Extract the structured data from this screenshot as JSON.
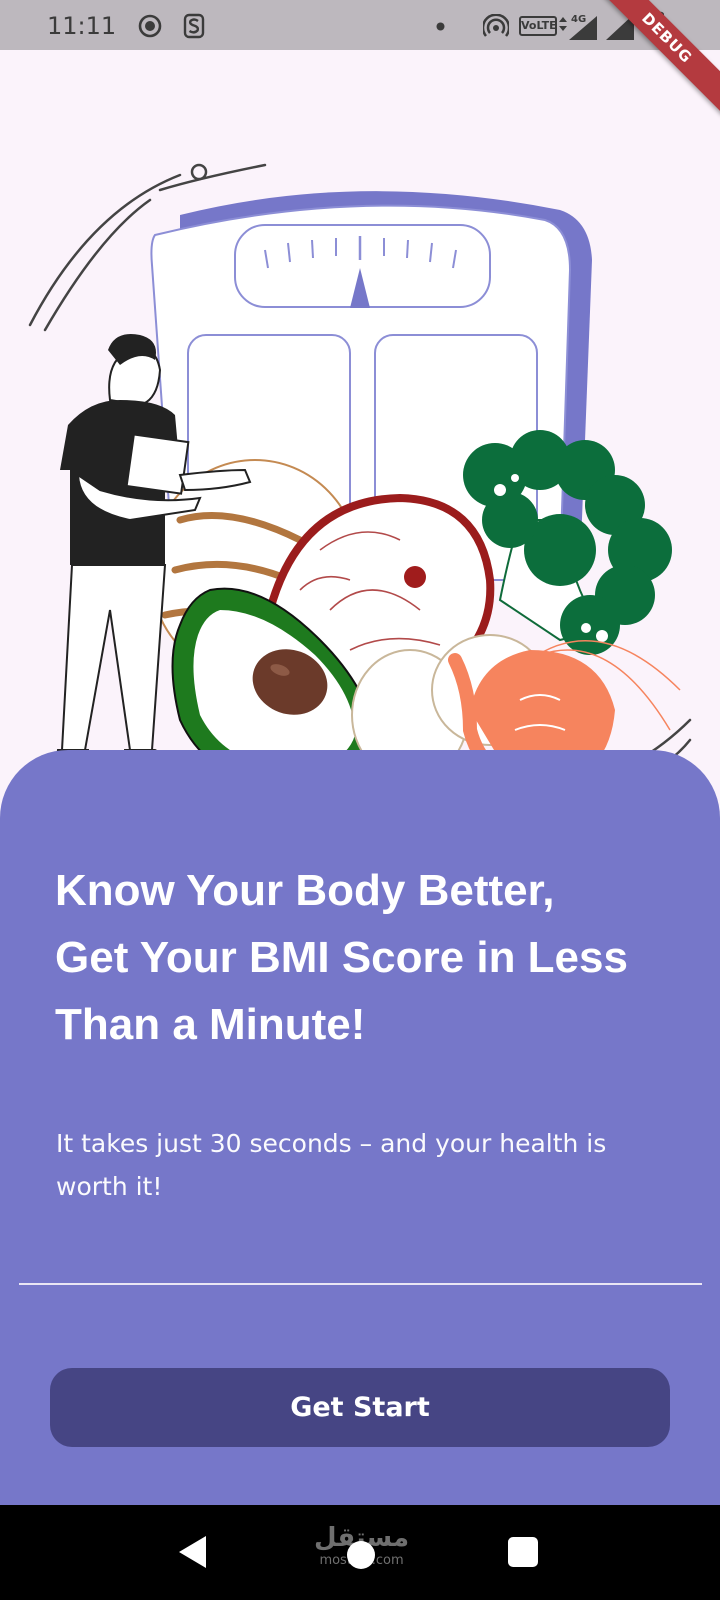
{
  "status_bar": {
    "time": "11:11",
    "icons": [
      "screen-record-icon",
      "s-badge-icon",
      "dot-icon",
      "hotspot-icon",
      "volte-icon",
      "signal-4g-icon",
      "signal-icon",
      "battery-icon"
    ],
    "volte_label": "VoLTE",
    "network_label": "4G"
  },
  "debug_banner": "DEBUG",
  "hero": {
    "illustration": "person-scale-healthy-food-illustration"
  },
  "content": {
    "headline": "Know Your Body Better,\n Get Your BMI Score in Less\nThan a Minute!",
    "subtext": "It takes just 30 seconds – and your health is worth it!",
    "button_label": "Get Start"
  },
  "nav_bar": {
    "watermark_arabic": "مستقل",
    "watermark_latin": "mostaql.com"
  },
  "colors": {
    "background": "#fbf3fb",
    "panel": "#7677c9",
    "button": "#464584",
    "text": "#ffffff"
  }
}
